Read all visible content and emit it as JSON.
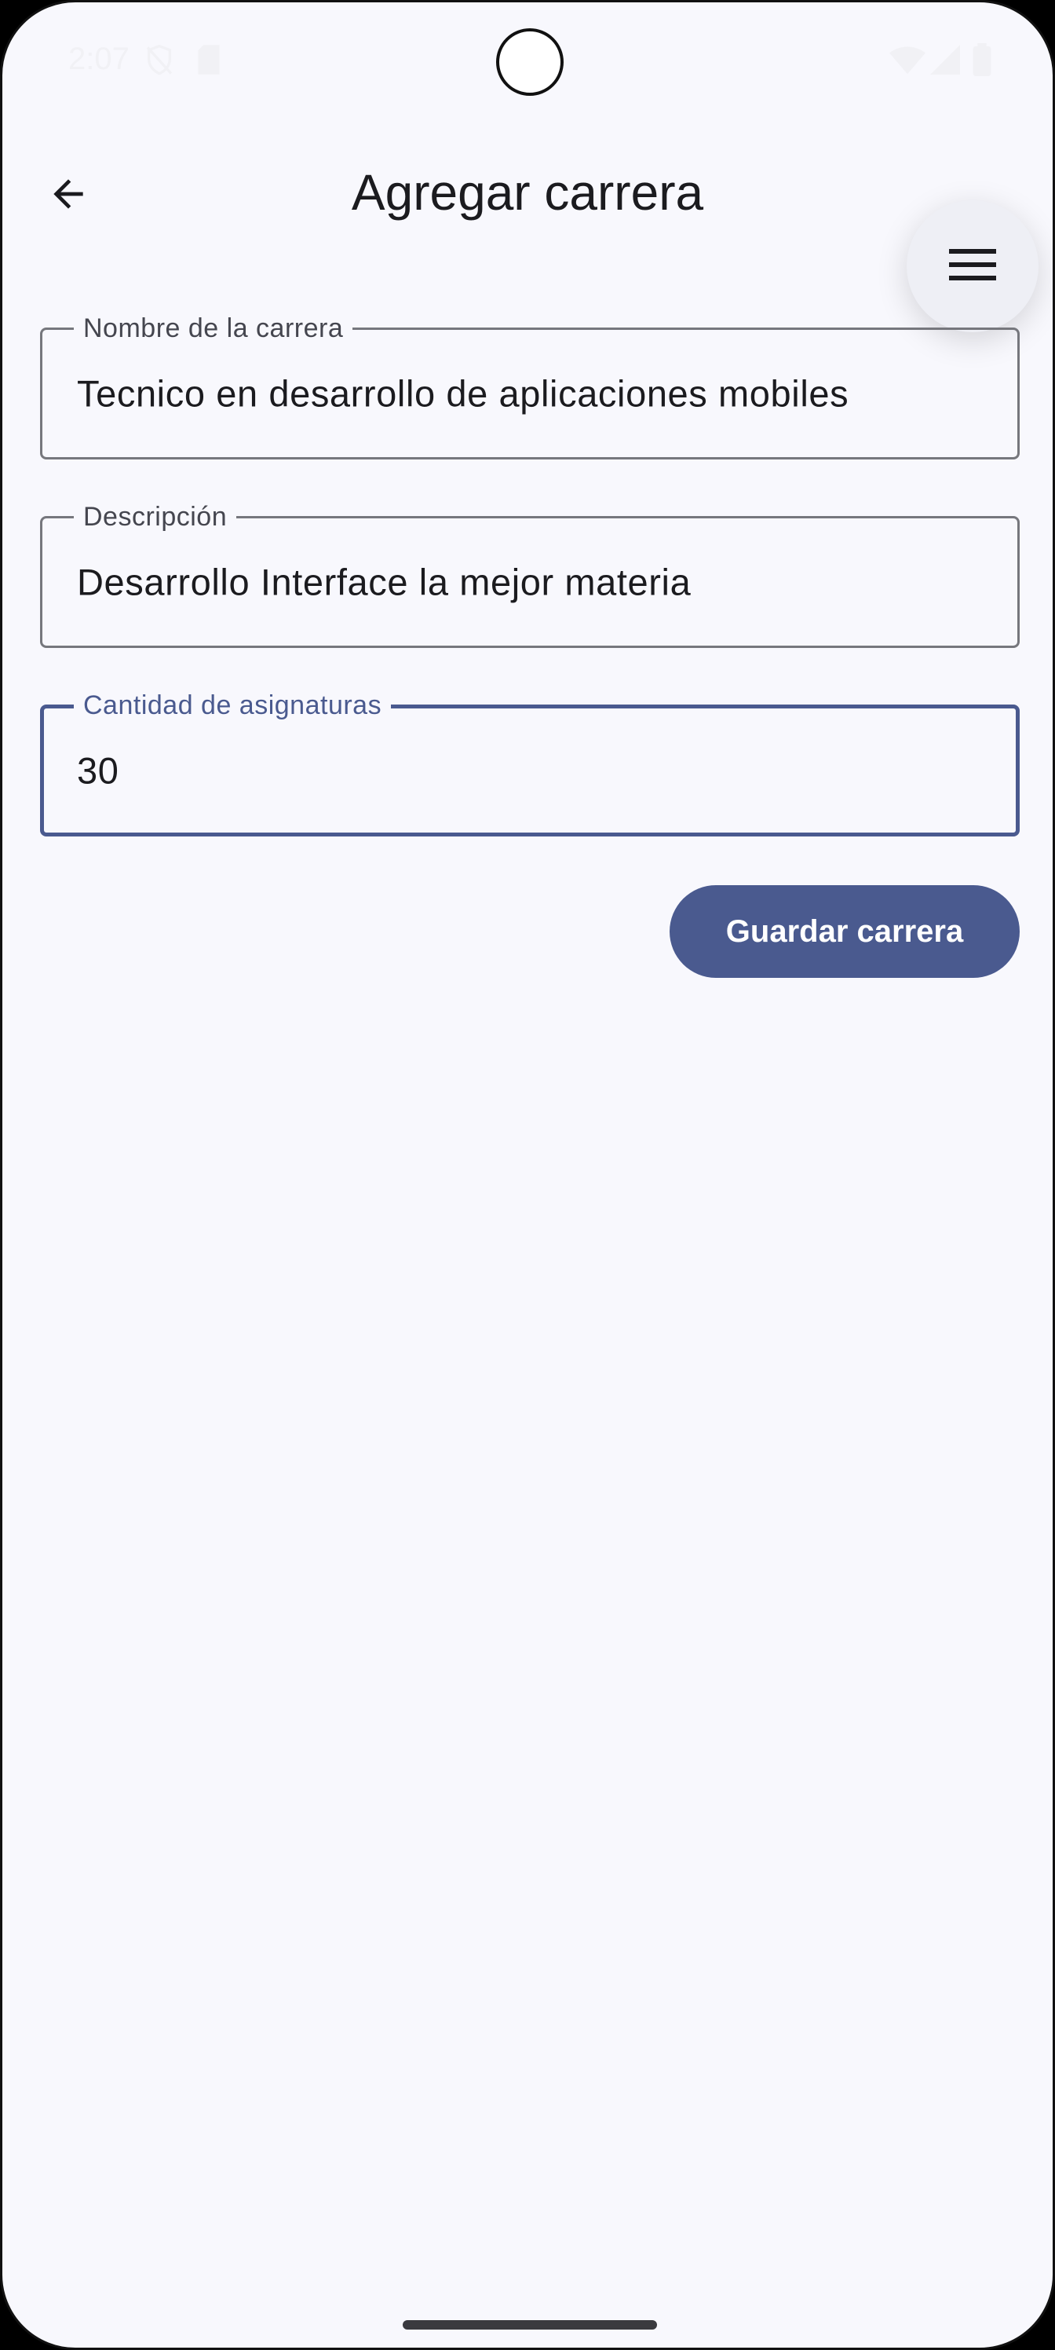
{
  "status_bar": {
    "time": "2:07",
    "icons": [
      "shield-off-icon",
      "sd-card-icon",
      "wifi-icon",
      "signal-icon",
      "battery-icon"
    ]
  },
  "app_bar": {
    "title": "Agregar carrera",
    "back_icon": "arrow-back-icon",
    "menu_icon": "menu-icon"
  },
  "form": {
    "fields": [
      {
        "label": "Nombre de la carrera",
        "value": "Tecnico en desarrollo de aplicaciones mobiles",
        "focused": false
      },
      {
        "label": "Descripción",
        "value": "Desarrollo Interface la mejor materia",
        "focused": false
      },
      {
        "label": "Cantidad de asignaturas",
        "value": "30",
        "focused": true
      }
    ],
    "save_label": "Guardar carrera"
  },
  "colors": {
    "background": "#f8f8fd",
    "primary": "#4a5a8f",
    "outline": "#76777d",
    "text": "#1b1b1f"
  }
}
